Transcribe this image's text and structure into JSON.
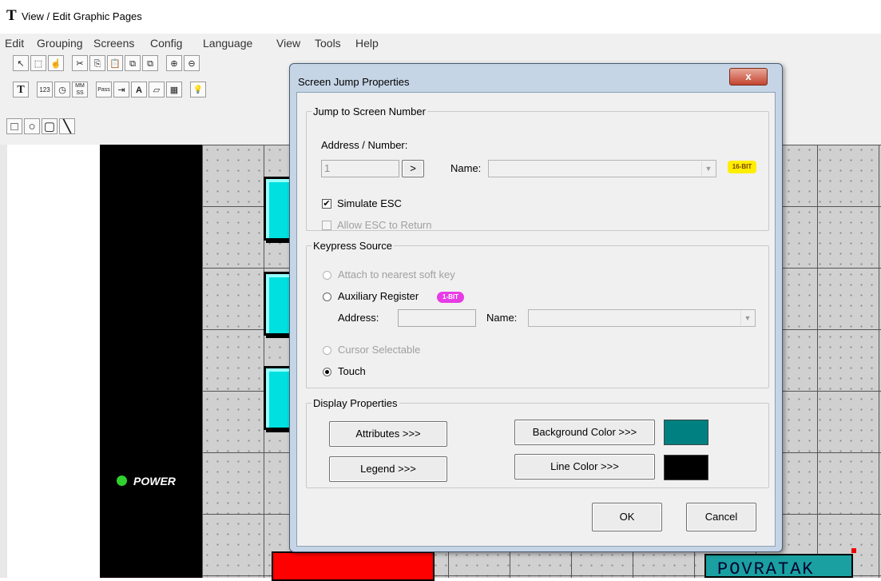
{
  "window": {
    "icon_glyph": "T",
    "title": "View / Edit Graphic Pages"
  },
  "menu": [
    "Edit",
    "Grouping",
    "Screens",
    "Config",
    "Language",
    "View",
    "Tools",
    "Help"
  ],
  "toolbar": {
    "row1": [
      {
        "icon": "pointer-icon",
        "glyph": "↖"
      },
      {
        "icon": "marquee-select-icon",
        "glyph": "⬚"
      },
      {
        "icon": "hand-pan-icon",
        "glyph": "☝"
      },
      {
        "icon": "cut-icon",
        "glyph": "✂"
      },
      {
        "icon": "copy-icon",
        "glyph": "⎘"
      },
      {
        "icon": "paste-icon",
        "glyph": "📋"
      },
      {
        "icon": "bring-front-icon",
        "glyph": "⧉"
      },
      {
        "icon": "send-back-icon",
        "glyph": "⧉"
      },
      {
        "icon": "zoom-in-icon",
        "glyph": "⊕"
      },
      {
        "icon": "zoom-out-icon",
        "glyph": "⊖"
      }
    ],
    "row2": [
      {
        "icon": "text-tool-icon",
        "glyph": "T"
      },
      {
        "icon": "numeric-icon",
        "glyph": "123"
      },
      {
        "icon": "clock-icon",
        "glyph": "◷"
      },
      {
        "icon": "time-mmss-icon",
        "glyph": "MM SS"
      },
      {
        "icon": "password-icon",
        "glyph": "Pass"
      },
      {
        "icon": "list-icon",
        "glyph": "⇥"
      },
      {
        "icon": "ascii-text-icon",
        "glyph": "A"
      },
      {
        "icon": "edit-field-icon",
        "glyph": "▱"
      },
      {
        "icon": "bitmap-icon",
        "glyph": "▦"
      },
      {
        "icon": "lamp-icon",
        "glyph": "💡"
      }
    ],
    "row3": [
      {
        "icon": "rectangle-icon",
        "glyph": "□"
      },
      {
        "icon": "circle-icon",
        "glyph": "○"
      },
      {
        "icon": "rounded-rect-icon",
        "glyph": "▢"
      },
      {
        "icon": "line-icon",
        "glyph": "╲"
      }
    ]
  },
  "canvas": {
    "power_label": "POWER",
    "button_label": "POVRATAK",
    "colors": {
      "background": "#000000",
      "grid": "#d0d0d0",
      "button_cyan": "#00e0e0",
      "red_block": "#ff0000",
      "teal_button": "#1aa0a0",
      "power_led": "#2fd12f"
    }
  },
  "dialog": {
    "title": "Screen Jump Properties",
    "close_glyph": "x",
    "jump_group": {
      "legend": "Jump to Screen Number",
      "address_label": "Address / Number:",
      "address_value": "1",
      "browse_glyph": ">",
      "name_label": "Name:",
      "name_value": "",
      "bit_badge": "16-BIT",
      "simulate_esc_label": "Simulate ESC",
      "simulate_esc_checked": true,
      "allow_esc_label": "Allow ESC to Return",
      "allow_esc_checked": false
    },
    "keypress_group": {
      "legend": "Keypress Source",
      "option_softkey": "Attach to nearest soft key",
      "option_aux": "Auxiliary Register",
      "aux_badge": "1-BIT",
      "address_label": "Address:",
      "address_value": "",
      "name_label": "Name:",
      "name_value": "",
      "option_cursor": "Cursor Selectable",
      "option_touch": "Touch",
      "selected": "Touch"
    },
    "display_group": {
      "legend": "Display Properties",
      "attributes_button": "Attributes >>>",
      "legend_button": "Legend >>>",
      "background_color_button": "Background Color >>>",
      "line_color_button": "Line Color >>>",
      "background_color": "#008080",
      "line_color": "#000000"
    },
    "ok_button": "OK",
    "cancel_button": "Cancel"
  }
}
